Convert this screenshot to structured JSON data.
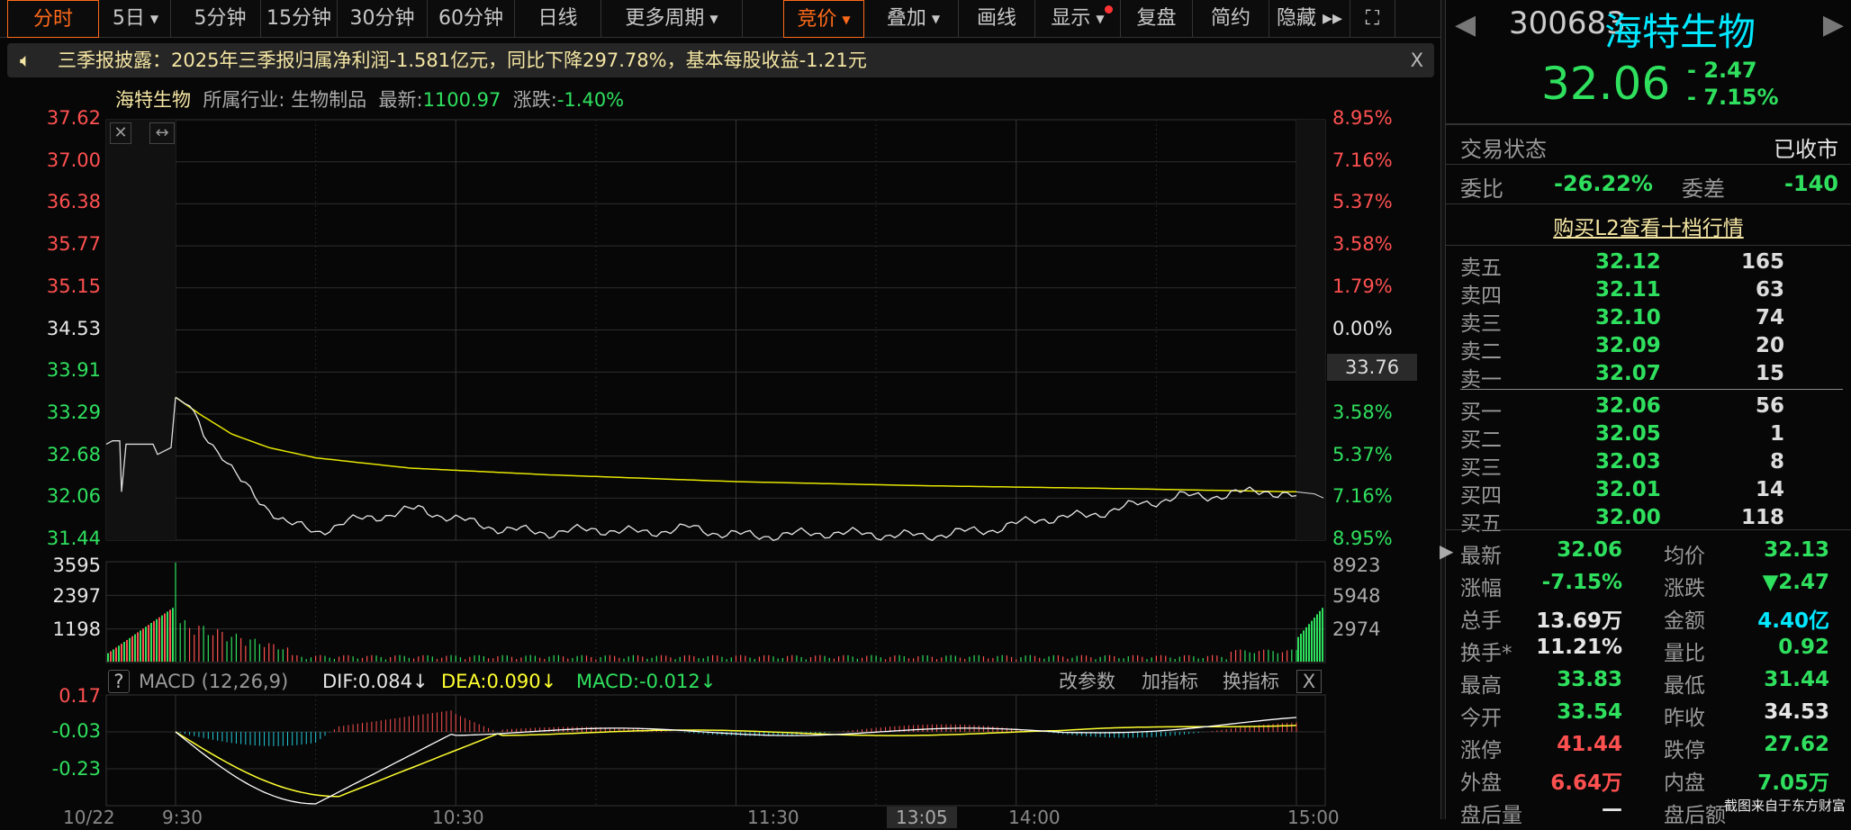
{
  "toolbar": {
    "items": [
      {
        "label": "分时",
        "active": true
      },
      {
        "label": "5日",
        "caret": true
      },
      {
        "label": "5分钟"
      },
      {
        "label": "15分钟"
      },
      {
        "label": "30分钟"
      },
      {
        "label": "60分钟"
      },
      {
        "label": "日线"
      },
      {
        "label": "更多周期",
        "caret": true
      },
      {
        "label": "竞价",
        "caret": true,
        "active": true
      },
      {
        "label": "叠加",
        "caret": true
      },
      {
        "label": "画线"
      },
      {
        "label": "显示",
        "caret": true,
        "dot": true
      },
      {
        "label": "复盘"
      },
      {
        "label": "简约"
      },
      {
        "label": "隐藏 ▸▸"
      }
    ]
  },
  "notice": {
    "text": "三季报披露：2025年三季报归属净利润-1.581亿元，同比下降297.78%，基本每股收益-1.21元",
    "close": "X"
  },
  "info": {
    "name": "海特生物",
    "industry_label": "所属行业:",
    "industry": "生物制品",
    "latest_label": "最新:",
    "latest": "1100.97",
    "change_label": "涨跌:",
    "change": "-1.40%"
  },
  "price_axis": [
    "37.62",
    "37.00",
    "36.38",
    "35.77",
    "35.15",
    "34.53",
    "33.91",
    "33.29",
    "32.68",
    "32.06",
    "31.44"
  ],
  "pct_axis": [
    "8.95%",
    "7.16%",
    "5.37%",
    "3.58%",
    "1.79%",
    "0.00%",
    "",
    "3.58%",
    "5.37%",
    "7.16%",
    "8.95%"
  ],
  "cursor_price": "33.76",
  "volume_axis": {
    "left": [
      "3595",
      "2397",
      "1198"
    ],
    "right": [
      "8923",
      "5948",
      "2974"
    ]
  },
  "macd": {
    "help": "?",
    "title": "MACD (12,26,9)",
    "dif": "DIF:0.084↓",
    "dea": "DEA:0.090↓",
    "macd": "MACD:-0.012↓",
    "buttons": [
      "改参数",
      "加指标",
      "换指标"
    ],
    "close": "X",
    "axis": [
      "0.17",
      "-0.03",
      "-0.23"
    ]
  },
  "chart_data": {
    "type": "line",
    "prev_close": 34.53,
    "ylim": [
      31.44,
      37.62
    ],
    "price": [
      [
        0,
        33.54
      ],
      [
        3,
        33.4
      ],
      [
        6,
        33.0
      ],
      [
        10,
        32.7
      ],
      [
        14,
        32.3
      ],
      [
        18,
        32.0
      ],
      [
        24,
        31.7
      ],
      [
        30,
        31.55
      ],
      [
        36,
        31.7
      ],
      [
        44,
        31.8
      ],
      [
        52,
        31.9
      ],
      [
        60,
        31.75
      ],
      [
        70,
        31.6
      ],
      [
        80,
        31.55
      ],
      [
        90,
        31.6
      ],
      [
        100,
        31.55
      ],
      [
        110,
        31.62
      ],
      [
        116,
        31.55
      ],
      [
        124,
        31.5
      ],
      [
        140,
        31.55
      ],
      [
        160,
        31.5
      ],
      [
        175,
        31.6
      ],
      [
        185,
        31.75
      ],
      [
        195,
        31.8
      ],
      [
        205,
        31.95
      ],
      [
        215,
        32.08
      ],
      [
        225,
        32.1
      ],
      [
        233,
        32.18
      ],
      [
        240,
        32.06
      ]
    ],
    "avg": [
      [
        0,
        33.54
      ],
      [
        5,
        33.3
      ],
      [
        12,
        33.0
      ],
      [
        20,
        32.8
      ],
      [
        30,
        32.65
      ],
      [
        50,
        32.5
      ],
      [
        80,
        32.4
      ],
      [
        120,
        32.3
      ],
      [
        160,
        32.24
      ],
      [
        200,
        32.2
      ],
      [
        240,
        32.15
      ]
    ]
  },
  "time_axis": [
    "10/22",
    "9:30",
    "10:30",
    "11:30",
    "13:05",
    "14:00",
    "15:00"
  ],
  "quote": {
    "code": "300683",
    "name": "海特生物",
    "price": "32.06",
    "change": "- 2.47",
    "change_pct": "- 7.15%"
  },
  "status": {
    "label": "交易状态",
    "value": "已收市"
  },
  "ratio": {
    "label": "委比",
    "value": "-26.22%",
    "diff_label": "委差",
    "diff": "-140"
  },
  "l2_link": "购买L2查看十档行情",
  "asks": [
    {
      "l": "卖五",
      "p": "32.12",
      "v": "165"
    },
    {
      "l": "卖四",
      "p": "32.11",
      "v": "63"
    },
    {
      "l": "卖三",
      "p": "32.10",
      "v": "74"
    },
    {
      "l": "卖二",
      "p": "32.09",
      "v": "20"
    },
    {
      "l": "卖一",
      "p": "32.07",
      "v": "15"
    }
  ],
  "bids": [
    {
      "l": "买一",
      "p": "32.06",
      "v": "56"
    },
    {
      "l": "买二",
      "p": "32.05",
      "v": "1"
    },
    {
      "l": "买三",
      "p": "32.03",
      "v": "8"
    },
    {
      "l": "买四",
      "p": "32.01",
      "v": "14"
    },
    {
      "l": "买五",
      "p": "32.00",
      "v": "118"
    }
  ],
  "stats": [
    {
      "l1": "最新",
      "v1": "32.06",
      "c1": "green",
      "l2": "均价",
      "v2": "32.13",
      "c2": "green"
    },
    {
      "l1": "涨幅",
      "v1": "-7.15%",
      "c1": "green",
      "l2": "涨跌",
      "v2": "▼2.47",
      "c2": "green"
    },
    {
      "l1": "总手",
      "v1": "13.69万",
      "c1": "white",
      "l2": "金额",
      "v2": "4.40亿",
      "c2": "cyan"
    },
    {
      "l1": "换手*",
      "v1": "11.21%",
      "c1": "white",
      "l2": "量比",
      "v2": "0.92",
      "c2": "green"
    },
    {
      "l1": "最高",
      "v1": "33.83",
      "c1": "green",
      "l2": "最低",
      "v2": "31.44",
      "c2": "green"
    },
    {
      "l1": "今开",
      "v1": "33.54",
      "c1": "green",
      "l2": "昨收",
      "v2": "34.53",
      "c2": "white"
    },
    {
      "l1": "涨停",
      "v1": "41.44",
      "c1": "red",
      "l2": "跌停",
      "v2": "27.62",
      "c2": "green"
    },
    {
      "l1": "外盘",
      "v1": "6.64万",
      "c1": "red",
      "l2": "内盘",
      "v2": "7.05万",
      "c2": "green"
    },
    {
      "l1": "盘后量",
      "v1": "—",
      "c1": "white",
      "l2": "盘后额",
      "v2": "",
      "c2": "white"
    }
  ],
  "watermark": "截图来自于东方财富",
  "colors": {
    "up": "#ff5050",
    "down": "#2fe05e",
    "avg": "#e6e600",
    "accent": "#ff6a1a"
  }
}
